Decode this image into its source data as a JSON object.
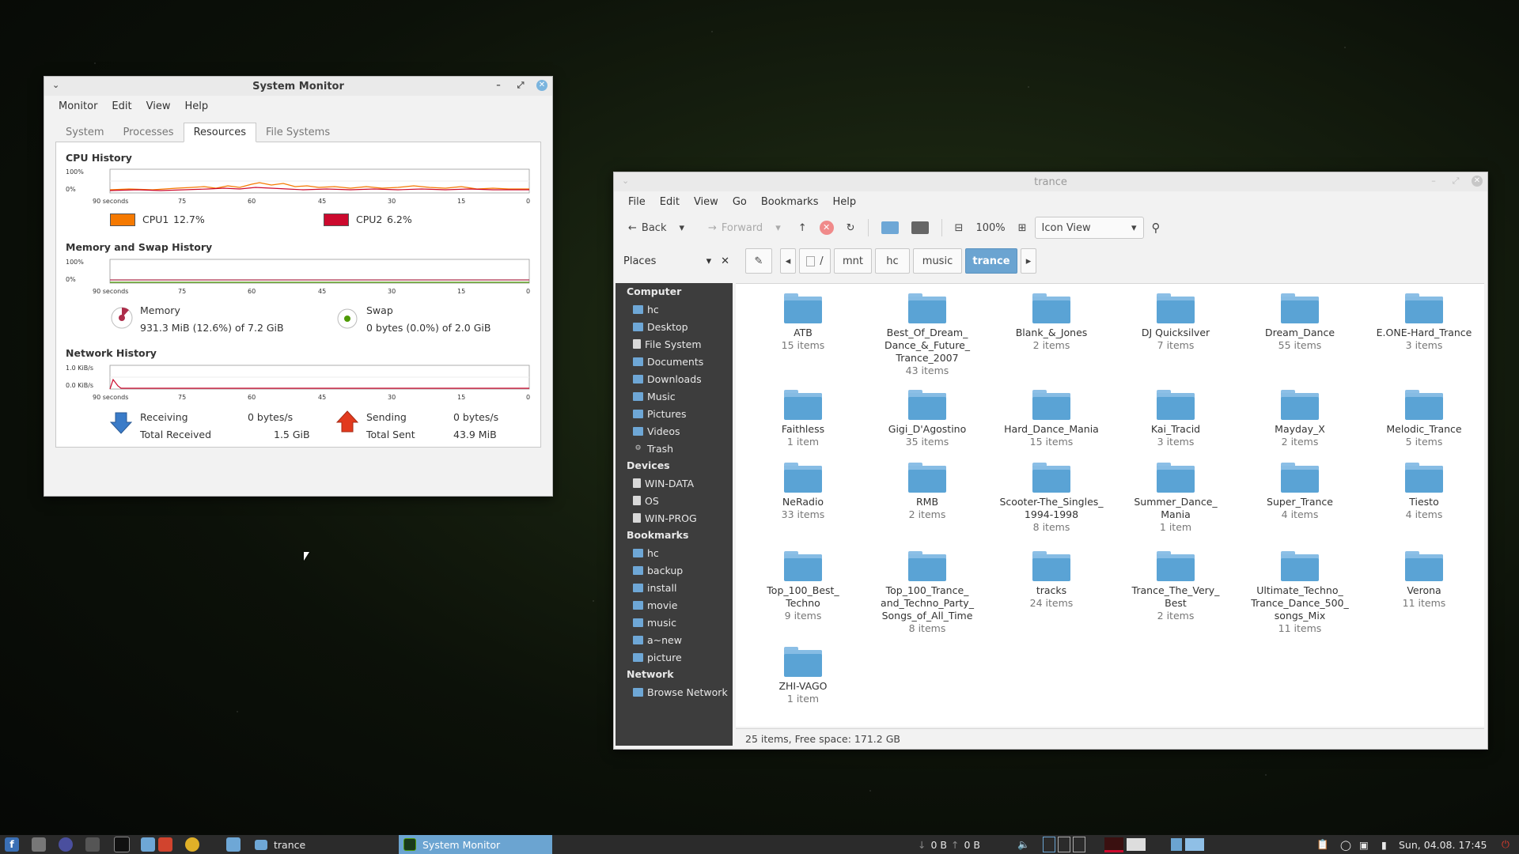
{
  "sysmon": {
    "title": "System Monitor",
    "menu": [
      "Monitor",
      "Edit",
      "View",
      "Help"
    ],
    "tabs": [
      "System",
      "Processes",
      "Resources",
      "File Systems"
    ],
    "active_tab": "Resources",
    "cpu": {
      "title": "CPU History",
      "y_top": "100%",
      "y_bottom": "0%",
      "x_ticks": [
        "90 seconds",
        "75",
        "60",
        "45",
        "30",
        "15",
        "0"
      ],
      "cpu1_label": "CPU1",
      "cpu1_value": "12.7%",
      "cpu1_color": "#f57900",
      "cpu2_label": "CPU2",
      "cpu2_value": "6.2%",
      "cpu2_color": "#cc0a2e"
    },
    "memory": {
      "title": "Memory and Swap History",
      "y_top": "100%",
      "y_bottom": "0%",
      "x_ticks": [
        "90 seconds",
        "75",
        "60",
        "45",
        "30",
        "15",
        "0"
      ],
      "mem_label": "Memory",
      "mem_value": "931.3 MiB (12.6%) of 7.2 GiB",
      "mem_color": "#ad2d4a",
      "swap_label": "Swap",
      "swap_value": "0 bytes (0.0%) of 2.0 GiB",
      "swap_color": "#4e9a06"
    },
    "network": {
      "title": "Network History",
      "y_top": "1.0 KiB/s",
      "y_bottom": "0.0 KiB/s",
      "x_ticks": [
        "90 seconds",
        "75",
        "60",
        "45",
        "30",
        "15",
        "0"
      ],
      "recv_label": "Receiving",
      "recv_value": "0 bytes/s",
      "total_recv_label": "Total Received",
      "total_recv_value": "1.5 GiB",
      "send_label": "Sending",
      "send_value": "0 bytes/s",
      "total_sent_label": "Total Sent",
      "total_sent_value": "43.9 MiB"
    }
  },
  "fm": {
    "title": "trance",
    "menu": [
      "File",
      "Edit",
      "View",
      "Go",
      "Bookmarks",
      "Help"
    ],
    "toolbar": {
      "back": "Back",
      "forward": "Forward",
      "zoom": "100%",
      "view_mode": "Icon View"
    },
    "places_label": "Places",
    "path": [
      "/",
      "mnt",
      "hc",
      "music",
      "trance"
    ],
    "sidebar": [
      {
        "type": "head",
        "label": "Computer"
      },
      {
        "type": "folder",
        "label": "hc"
      },
      {
        "type": "folder",
        "label": "Desktop"
      },
      {
        "type": "drive",
        "label": "File System"
      },
      {
        "type": "folder",
        "label": "Documents"
      },
      {
        "type": "folder",
        "label": "Downloads"
      },
      {
        "type": "folder",
        "label": "Music"
      },
      {
        "type": "folder",
        "label": "Pictures"
      },
      {
        "type": "folder",
        "label": "Videos"
      },
      {
        "type": "trash",
        "label": "Trash"
      },
      {
        "type": "head",
        "label": "Devices"
      },
      {
        "type": "drive",
        "label": "WIN-DATA"
      },
      {
        "type": "drive",
        "label": "OS"
      },
      {
        "type": "drive",
        "label": "WIN-PROG"
      },
      {
        "type": "head",
        "label": "Bookmarks"
      },
      {
        "type": "folder",
        "label": "hc"
      },
      {
        "type": "folder",
        "label": "backup"
      },
      {
        "type": "folder",
        "label": "install"
      },
      {
        "type": "folder",
        "label": "movie"
      },
      {
        "type": "folder",
        "label": "music"
      },
      {
        "type": "folder",
        "label": "a~new"
      },
      {
        "type": "folder",
        "label": "picture"
      },
      {
        "type": "head",
        "label": "Network"
      },
      {
        "type": "folder",
        "label": "Browse Network"
      }
    ],
    "folders": [
      {
        "name": "ATB",
        "count": "15 items"
      },
      {
        "name": "Best_Of_Dream_ Dance_&_Future_ Trance_2007",
        "count": "43 items"
      },
      {
        "name": "Blank_&_Jones",
        "count": "2 items"
      },
      {
        "name": "DJ Quicksilver",
        "count": "7 items"
      },
      {
        "name": "Dream_Dance",
        "count": "55 items"
      },
      {
        "name": "E.ONE-Hard_Trance",
        "count": "3 items"
      },
      {
        "name": "Faithless",
        "count": "1 item"
      },
      {
        "name": "Gigi_D'Agostino",
        "count": "35 items"
      },
      {
        "name": "Hard_Dance_Mania",
        "count": "15 items"
      },
      {
        "name": "Kai_Tracid",
        "count": "3 items"
      },
      {
        "name": "Mayday_X",
        "count": "2 items"
      },
      {
        "name": "Melodic_Trance",
        "count": "5 items"
      },
      {
        "name": "NeRadio",
        "count": "33 items"
      },
      {
        "name": "RMB",
        "count": "2 items"
      },
      {
        "name": "Scooter-The_Singles_ 1994-1998",
        "count": "8 items"
      },
      {
        "name": "Summer_Dance_ Mania",
        "count": "1 item"
      },
      {
        "name": "Super_Trance",
        "count": "4 items"
      },
      {
        "name": "Tiesto",
        "count": "4 items"
      },
      {
        "name": "Top_100_Best_ Techno",
        "count": "9 items"
      },
      {
        "name": "Top_100_Trance_ and_Techno_Party_ Songs_of_All_Time",
        "count": "8 items"
      },
      {
        "name": "tracks",
        "count": "24 items"
      },
      {
        "name": "Trance_The_Very_ Best",
        "count": "2 items"
      },
      {
        "name": "Ultimate_Techno_ Trance_Dance_500_ songs_Mix",
        "count": "11 items"
      },
      {
        "name": "Verona",
        "count": "11 items"
      },
      {
        "name": "ZHI-VAGO",
        "count": "1 item"
      }
    ],
    "status": "25 items, Free space: 171.2 GB"
  },
  "taskbar": {
    "tasks": [
      {
        "label": "trance",
        "active": false
      },
      {
        "label": "System Monitor",
        "active": true
      }
    ],
    "net_down": "0 B",
    "net_up": "0 B",
    "clock": "Sun, 04.08.   17:45"
  }
}
